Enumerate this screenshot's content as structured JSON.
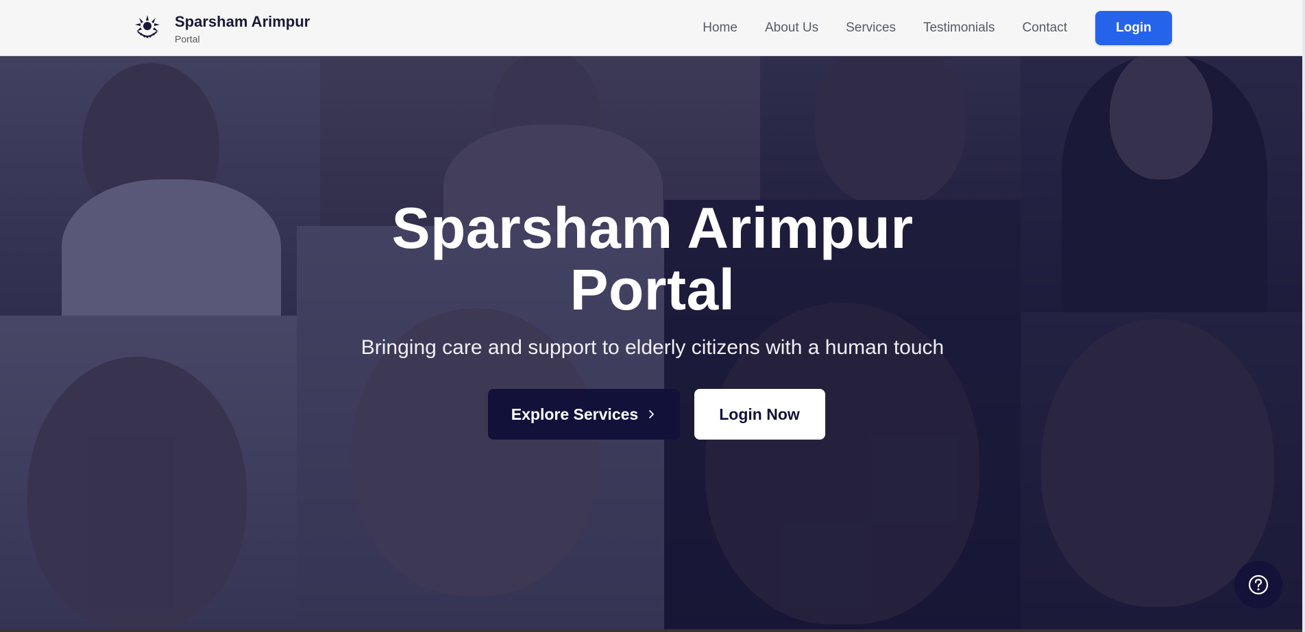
{
  "brand": {
    "title": "Sparsham Arimpur",
    "subtitle": "Portal",
    "logo_icon": "sun-lotus-logo-icon"
  },
  "nav": {
    "links": [
      "Home",
      "About Us",
      "Services",
      "Testimonials",
      "Contact"
    ],
    "login_label": "Login",
    "accent_color": "#2563eb"
  },
  "hero": {
    "title_line1": "Sparsham Arimpur",
    "title_line2": "Portal",
    "subtitle": "Bringing care and support to elderly citizens with a human touch",
    "explore_label": "Explore Services",
    "explore_icon": "chevron-right-icon",
    "login_now_label": "Login Now",
    "overlay_color": "#16144a"
  },
  "help": {
    "icon": "question-circle-icon"
  }
}
